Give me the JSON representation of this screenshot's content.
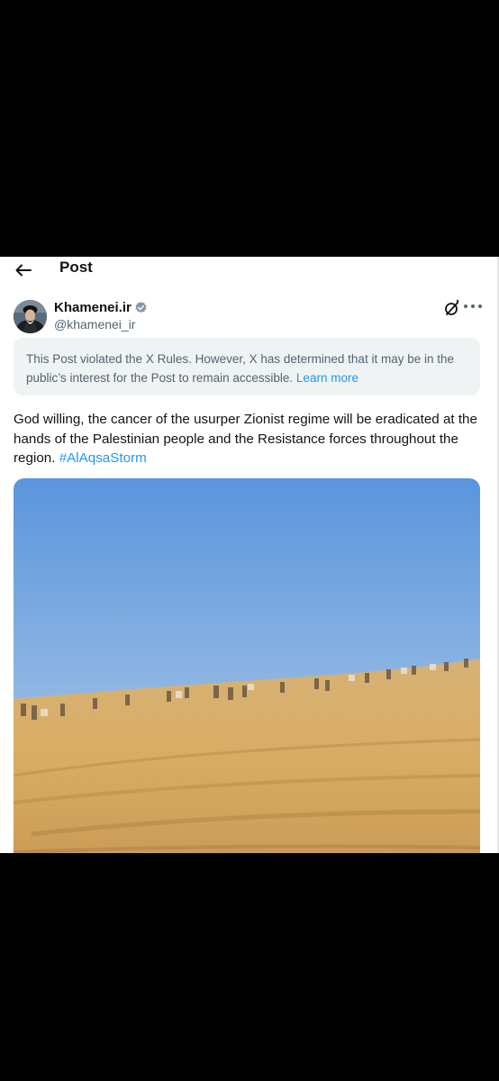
{
  "header": {
    "title": "Post",
    "back_icon": "arrow-left-icon"
  },
  "author": {
    "name": "Khamenei.ir",
    "handle": "@khamenei_ir",
    "verified_color": "#829aab"
  },
  "notice": {
    "text": "This Post violated the X Rules. However, X has determined that it may be in the public’s interest for the Post to remain accessible.",
    "link": "Learn more"
  },
  "post": {
    "text": "God willing, the cancer of the usurper Zionist regime will be eradicated at the hands of the Palestinian people and the Resistance forces throughout the region.",
    "hashtag": "#AlAqsaStorm"
  },
  "media": {
    "type": "video",
    "scene": "desert"
  },
  "colors": {
    "accent": "#1d9bf0",
    "text": "#0f1419",
    "muted": "#536471",
    "notice_bg": "#eff3f4"
  },
  "icons": [
    "arrow-left-icon",
    "verified-badge-icon",
    "grok-icon",
    "more-icon"
  ]
}
